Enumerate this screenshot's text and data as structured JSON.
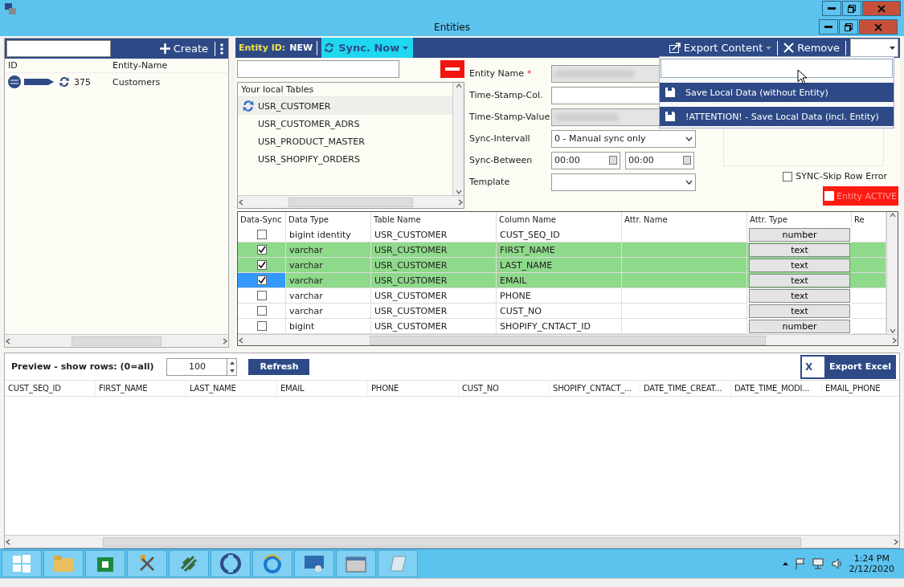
{
  "window": {
    "title": "Entities"
  },
  "entity_list": {
    "create_label": "Create",
    "columns": [
      "ID",
      "Entity-Name"
    ],
    "rows": [
      {
        "id": "375",
        "name": "Customers"
      }
    ]
  },
  "toolbar": {
    "entity_id_label": "Entity ID:",
    "entity_id": "NEW",
    "sync_label": "Sync. Now",
    "export_label": "Export Content",
    "remove_label": "Remove"
  },
  "local_tables": {
    "header": "Your local Tables",
    "items": [
      {
        "name": "USR_CUSTOMER",
        "selected": true
      },
      {
        "name": "USR_CUSTOMER_ADRS",
        "selected": false
      },
      {
        "name": "USR_PRODUCT_MASTER",
        "selected": false
      },
      {
        "name": "USR_SHOPIFY_ORDERS",
        "selected": false
      }
    ]
  },
  "form": {
    "entity_name_label": "Entity Name",
    "required_mark": "*",
    "timestamp_col_label": "Time-Stamp-Col.",
    "timestamp_value_label": "Time-Stamp-Value",
    "sync_interval_label": "Sync-Intervall",
    "sync_interval_value": "0 - Manual sync only",
    "sync_between_label": "Sync-Between",
    "sync_from": "00:00",
    "sync_to": "00:00",
    "template_label": "Template"
  },
  "skip_row_error": {
    "label": "SYNC-Skip Row Error",
    "checked": false
  },
  "entity_active": {
    "label": "Entity ACTIVE",
    "checked": false
  },
  "export_menu": {
    "items": [
      {
        "label": "Save Local Data (without Entity)"
      },
      {
        "label": "!ATTENTION! - Save Local Data (incl. Entity)"
      }
    ]
  },
  "columns_grid": {
    "columns": [
      "Data-Sync",
      "Data Type",
      "Table Name",
      "Column Name",
      "Attr. Name",
      "Attr. Type",
      "Re"
    ],
    "rows": [
      {
        "checked": false,
        "selected": false,
        "data_type": "bigint identity",
        "table": "USR_CUSTOMER",
        "column": "CUST_SEQ_ID",
        "attr_type": "number"
      },
      {
        "checked": true,
        "selected": false,
        "data_type": "varchar",
        "table": "USR_CUSTOMER",
        "column": "FIRST_NAME",
        "attr_type": "text"
      },
      {
        "checked": true,
        "selected": false,
        "data_type": "varchar",
        "table": "USR_CUSTOMER",
        "column": "LAST_NAME",
        "attr_type": "text"
      },
      {
        "checked": true,
        "selected": true,
        "data_type": "varchar",
        "table": "USR_CUSTOMER",
        "column": "EMAIL",
        "attr_type": "text"
      },
      {
        "checked": false,
        "selected": false,
        "data_type": "varchar",
        "table": "USR_CUSTOMER",
        "column": "PHONE",
        "attr_type": "text"
      },
      {
        "checked": false,
        "selected": false,
        "data_type": "varchar",
        "table": "USR_CUSTOMER",
        "column": "CUST_NO",
        "attr_type": "text"
      },
      {
        "checked": false,
        "selected": false,
        "data_type": "bigint",
        "table": "USR_CUSTOMER",
        "column": "SHOPIFY_CNTACT_ID",
        "attr_type": "number"
      }
    ]
  },
  "preview": {
    "label": "Preview - show rows: (0=all)",
    "rows_value": "100",
    "refresh_label": "Refresh",
    "export_excel_label": "Export Excel",
    "excel_letter": "X",
    "columns": [
      "CUST_SEQ_ID",
      "FIRST_NAME",
      "LAST_NAME",
      "EMAIL",
      "PHONE",
      "CUST_NO",
      "SHOPIFY_CNTACT_...",
      "DATE_TIME_CREAT...",
      "DATE_TIME_MODI...",
      "EMAIL_PHONE"
    ]
  },
  "taskbar": {
    "time": "1:24 PM",
    "date": "2/12/2020"
  }
}
